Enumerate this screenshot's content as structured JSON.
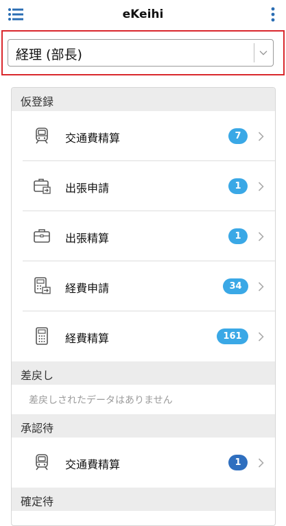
{
  "header": {
    "title": "eKeihi"
  },
  "role_select": {
    "value": "経理 (部長)"
  },
  "sections": {
    "provisional": {
      "title": "仮登録"
    },
    "returned": {
      "title": "差戻し",
      "empty_text": "差戻しされたデータはありません"
    },
    "awaiting_approval": {
      "title": "承認待"
    },
    "awaiting_confirmation": {
      "title": "確定待"
    }
  },
  "provisional_items": [
    {
      "label": "交通費精算",
      "count": "7",
      "icon": "train-icon"
    },
    {
      "label": "出張申請",
      "count": "1",
      "icon": "briefcase-arrow-icon"
    },
    {
      "label": "出張精算",
      "count": "1",
      "icon": "briefcase-icon"
    },
    {
      "label": "経費申請",
      "count": "34",
      "icon": "calculator-arrow-icon"
    },
    {
      "label": "経費精算",
      "count": "161",
      "icon": "calculator-icon"
    }
  ],
  "approval_items": [
    {
      "label": "交通費精算",
      "count": "1",
      "icon": "train-icon"
    }
  ],
  "colors": {
    "badge": "#3aa8e6",
    "badge_approval": "#2f6fbf",
    "highlight_border": "#d9262b",
    "menu_icon": "#2a6db3"
  }
}
